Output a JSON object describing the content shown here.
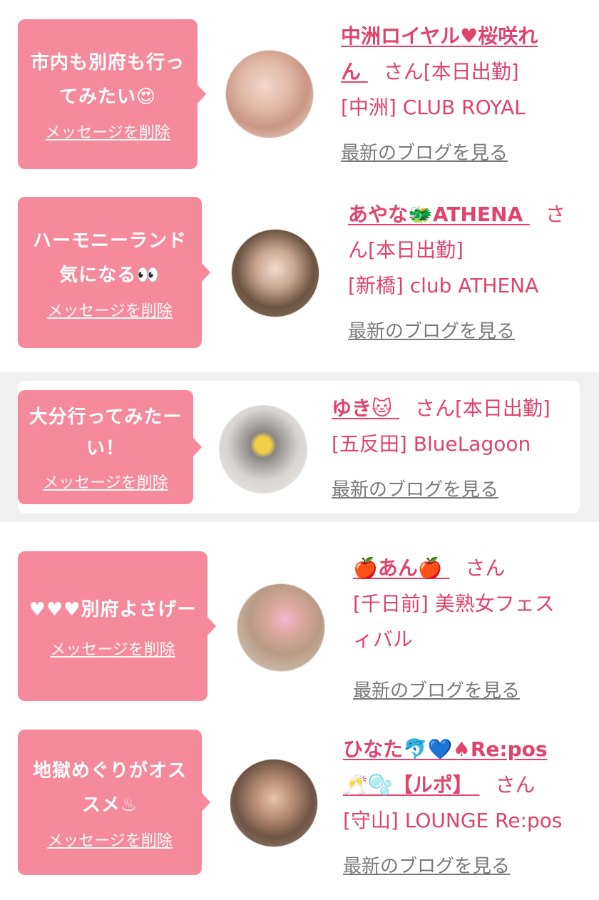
{
  "cards": [
    {
      "bubble_line1": "市内も別府も行っ",
      "bubble_line2": "てみたい😍",
      "delete_label": "メッセージを削除",
      "name_line1": "中洲ロイヤル♥桜咲れ",
      "name_line2": "ん",
      "san": "さん",
      "status": "[本日出勤]",
      "shop": "[中洲] CLUB ROYAL",
      "blog_label": "最新のブログを見る"
    },
    {
      "bubble_line1": "ハーモニーランド",
      "bubble_line2": "気になる👀",
      "delete_label": "メッセージを削除",
      "name_line1": "あやな🐲ATHENA",
      "san": "さ",
      "san_line2": "ん",
      "status": "[本日出勤]",
      "shop": "[新橋] club ATHENA",
      "blog_label": "最新のブログを見る"
    },
    {
      "bubble_line1": "大分行ってみたー",
      "bubble_line2": "い！",
      "delete_label": "メッセージを削除",
      "name_line1": "ゆき🐱",
      "san": "さん",
      "status": "[本日出勤]",
      "shop": "[五反田] BlueLagoon",
      "blog_label": "最新のブログを見る"
    },
    {
      "bubble_line1": "♥♥♥別府よさげー",
      "delete_label": "メッセージを削除",
      "name_line1": "🍎あん🍎",
      "san": "さん",
      "shop_line1": "[千日前] 美熟女フェス",
      "shop_line2": "ィバル",
      "blog_label": "最新のブログを見る"
    },
    {
      "bubble_line1": "地獄めぐりがオス",
      "bubble_line2": "スメ♨",
      "delete_label": "メッセージを削除",
      "name_line1": "ひなた🐬💙♠Re:pos",
      "name_line2": "🥂🫧【ルポ】",
      "san": "さん",
      "shop": "[守山] LOUNGE Re:pos",
      "blog_label": "最新のブログを見る"
    }
  ],
  "colors": {
    "bubble": "#f58a9c",
    "accent_text": "#e0436b",
    "link_gray": "#7a7a7a"
  }
}
